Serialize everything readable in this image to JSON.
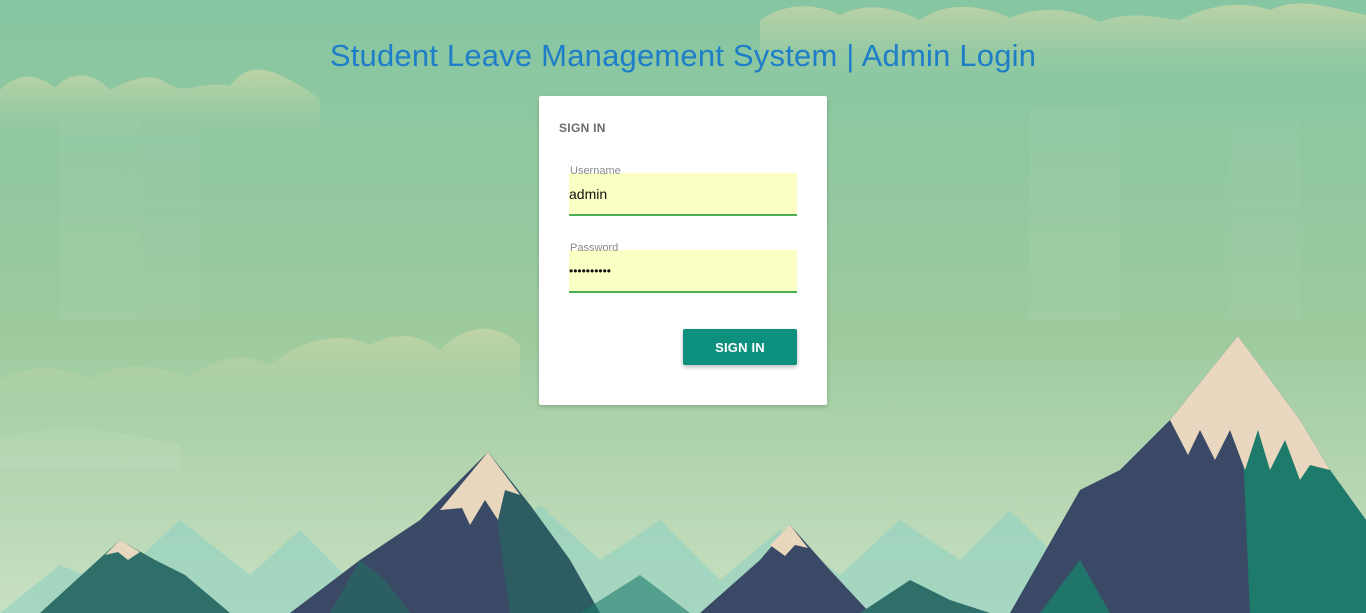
{
  "header": {
    "title": "Student Leave Management System | Admin Login"
  },
  "login_card": {
    "heading": "SIGN IN",
    "username": {
      "label": "Username",
      "value": "admin"
    },
    "password": {
      "label": "Password",
      "value": "••••••••••"
    },
    "submit_label": "SIGN IN"
  },
  "colors": {
    "title": "#1e7ec8",
    "button": "#0e907f",
    "input_fill": "#fbffc4",
    "input_underline": "#4caf50",
    "sky_top": "#86c6a2",
    "sky_bottom": "#c4dfc0",
    "mountain_dark": "#3a4a66",
    "mountain_teal": "#1e7a6a"
  }
}
